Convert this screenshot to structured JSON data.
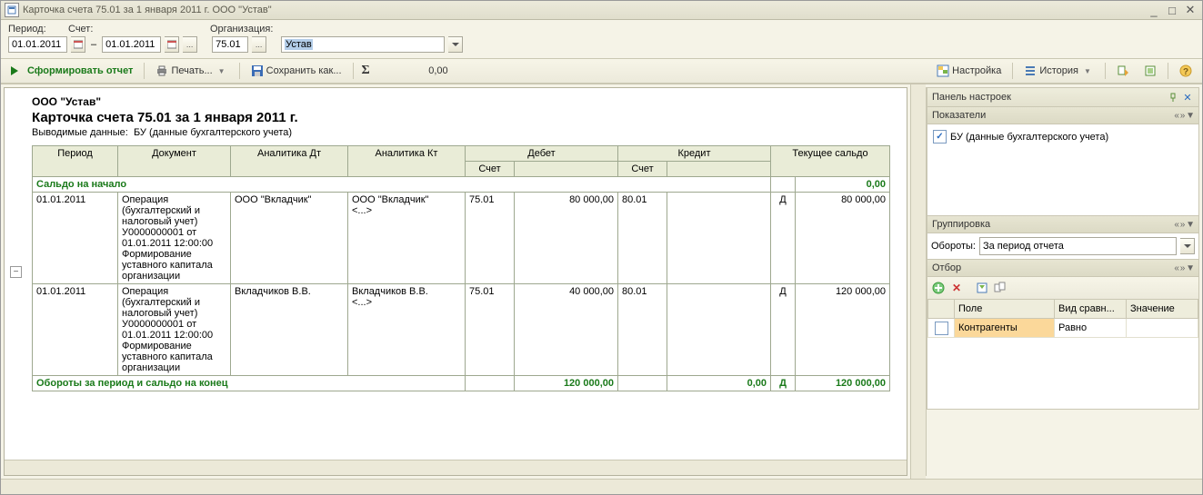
{
  "window": {
    "title": "Карточка счета 75.01 за 1 января 2011 г. ООО \"Устав\""
  },
  "params": {
    "period_label": "Период:",
    "date_from": "01.01.2011",
    "date_sep": "–",
    "date_to": "01.01.2011",
    "account_label": "Счет:",
    "account": "75.01",
    "org_label": "Организация:",
    "org": "Устав"
  },
  "toolbar": {
    "run": "Сформировать отчет",
    "print": "Печать...",
    "saveas": "Сохранить как...",
    "sum": "0,00",
    "settings": "Настройка",
    "history": "История"
  },
  "report": {
    "org_title": "ООО \"Устав\"",
    "title": "Карточка счета 75.01 за 1 января 2011 г.",
    "subinfo_label": "Выводимые данные:",
    "subinfo_val": "БУ (данные бухгалтерского учета)",
    "cols": {
      "period": "Период",
      "doc": "Документ",
      "an_dt": "Аналитика Дт",
      "an_kt": "Аналитика Кт",
      "debit": "Дебет",
      "credit": "Кредит",
      "balance": "Текущее сальдо",
      "acct": "Счет"
    },
    "balance_start": "Сальдо на начало",
    "balance_start_val": "0,00",
    "rows": [
      {
        "period": "01.01.2011",
        "doc": "Операция (бухгалтерский и налоговый учет) У0000000001 от 01.01.2011 12:00:00\nФормирование уставного капитала организации",
        "an_dt": "ООО \"Вкладчик\"",
        "an_kt": "ООО \"Вкладчик\"\n<...>",
        "dacct": "75.01",
        "damt": "80 000,00",
        "cacct": "80.01",
        "camt": "",
        "dk": "Д",
        "bal": "80 000,00"
      },
      {
        "period": "01.01.2011",
        "doc": "Операция (бухгалтерский и налоговый учет) У0000000001 от 01.01.2011 12:00:00\nФормирование уставного капитала организации",
        "an_dt": "Вкладчиков В.В.",
        "an_kt": "Вкладчиков В.В.\n<...>",
        "dacct": "75.01",
        "damt": "40 000,00",
        "cacct": "80.01",
        "camt": "",
        "dk": "Д",
        "bal": "120 000,00"
      }
    ],
    "turnover_label": "Обороты за период и сальдо на конец",
    "turnover": {
      "debit": "120 000,00",
      "credit": "0,00",
      "dk": "Д",
      "bal": "120 000,00"
    }
  },
  "settings": {
    "panel_title": "Панель настроек",
    "indicators": {
      "title": "Показатели",
      "bu": "БУ (данные бухгалтерского учета)"
    },
    "grouping": {
      "title": "Группировка",
      "turns_label": "Обороты:",
      "turns_val": "За период отчета"
    },
    "filter": {
      "title": "Отбор",
      "cols": {
        "field": "Поле",
        "cmp": "Вид сравн...",
        "val": "Значение"
      },
      "row": {
        "field": "Контрагенты",
        "cmp": "Равно",
        "val": ""
      }
    },
    "arrows": "« » ▼"
  }
}
